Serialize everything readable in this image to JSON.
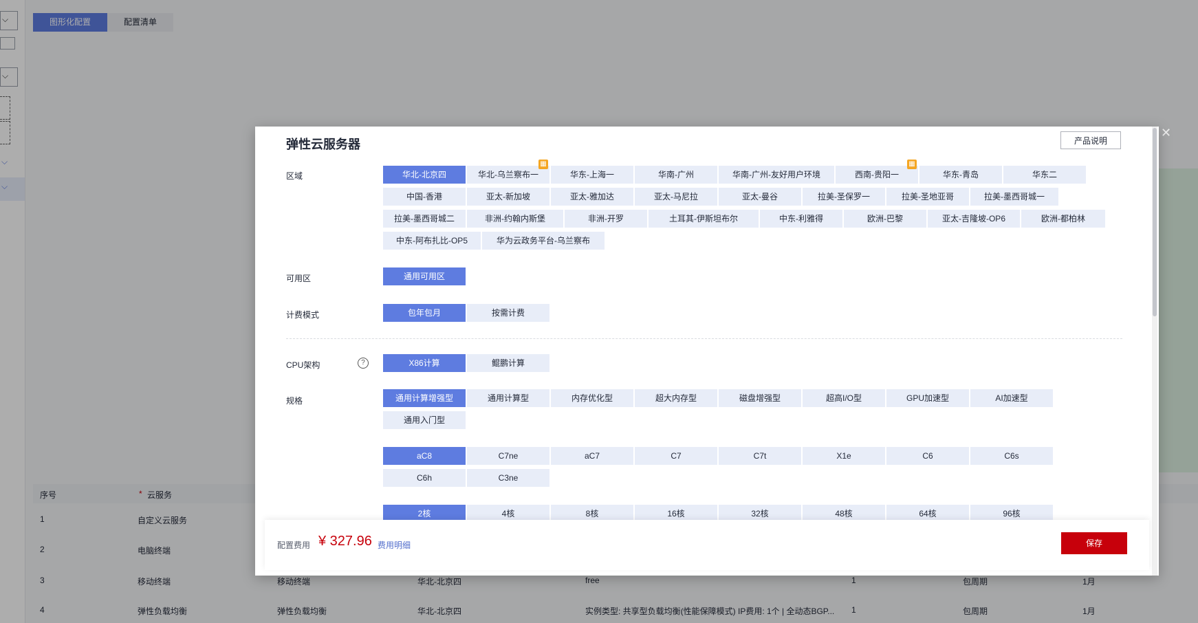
{
  "page": {
    "tabs": [
      "图形化配置",
      "配置清单"
    ],
    "table_headers": [
      "序号",
      "云服务"
    ],
    "rows": [
      {
        "no": "1",
        "service": "自定义云服务"
      },
      {
        "no": "2",
        "service": "电脑终端"
      },
      {
        "no": "3",
        "service": "移动终端",
        "type": "移动终端",
        "region": "华北-北京四",
        "spec": "free",
        "qty": "1",
        "billing": "包周期",
        "period": "1月"
      },
      {
        "no": "4",
        "service": "弹性负载均衡",
        "type": "弹性负载均衡",
        "region": "华北-北京四",
        "spec": "实例类型: 共享型负载均衡(性能保障模式) IP费用: 1个 | 全动态BGP...",
        "qty": "1",
        "billing": "包周期",
        "period": "1月"
      }
    ]
  },
  "modal": {
    "title": "弹性云服务器",
    "doc_button": "产品说明",
    "labels": {
      "region": "区域",
      "az": "可用区",
      "billing": "计费模式",
      "cpu": "CPU架构",
      "spec": "规格"
    },
    "regions": [
      "华北-北京四",
      "华北-乌兰察布一",
      "华东-上海一",
      "华南-广州",
      "华南-广州-友好用户环境",
      "西南-贵阳一",
      "华东-青岛",
      "华东二",
      "中国-香港",
      "亚太-新加坡",
      "亚太-雅加达",
      "亚太-马尼拉",
      "亚太-曼谷",
      "拉美-圣保罗一",
      "拉美-圣地亚哥",
      "拉美-墨西哥城一",
      "拉美-墨西哥城二",
      "非洲-约翰内斯堡",
      "非洲-开罗",
      "土耳其-伊斯坦布尔",
      "中东-利雅得",
      "欧洲-巴黎",
      "亚太-吉隆坡-OP6",
      "欧洲-都柏林",
      "中东-阿布扎比-OP5",
      "华为云政务平台-乌兰察布"
    ],
    "az": [
      "通用可用区"
    ],
    "billing_modes": [
      "包年包月",
      "按需计费"
    ],
    "cpu_arch": [
      "X86计算",
      "鲲鹏计算"
    ],
    "spec_types": [
      "通用计算增强型",
      "通用计算型",
      "内存优化型",
      "超大内存型",
      "磁盘增强型",
      "超高I/O型",
      "GPU加速型",
      "AI加速型",
      "通用入门型"
    ],
    "series": [
      "aC8",
      "C7ne",
      "aC7",
      "C7",
      "C7t",
      "X1e",
      "C6",
      "C6s",
      "C6h",
      "C3ne"
    ],
    "cores": [
      "2核",
      "4核",
      "8核",
      "16核",
      "32核",
      "48核",
      "64核",
      "96核"
    ],
    "footer": {
      "fee_label": "配置费用",
      "fee_value": "¥ 327.96",
      "fee_link": "费用明细",
      "save": "保存"
    }
  }
}
